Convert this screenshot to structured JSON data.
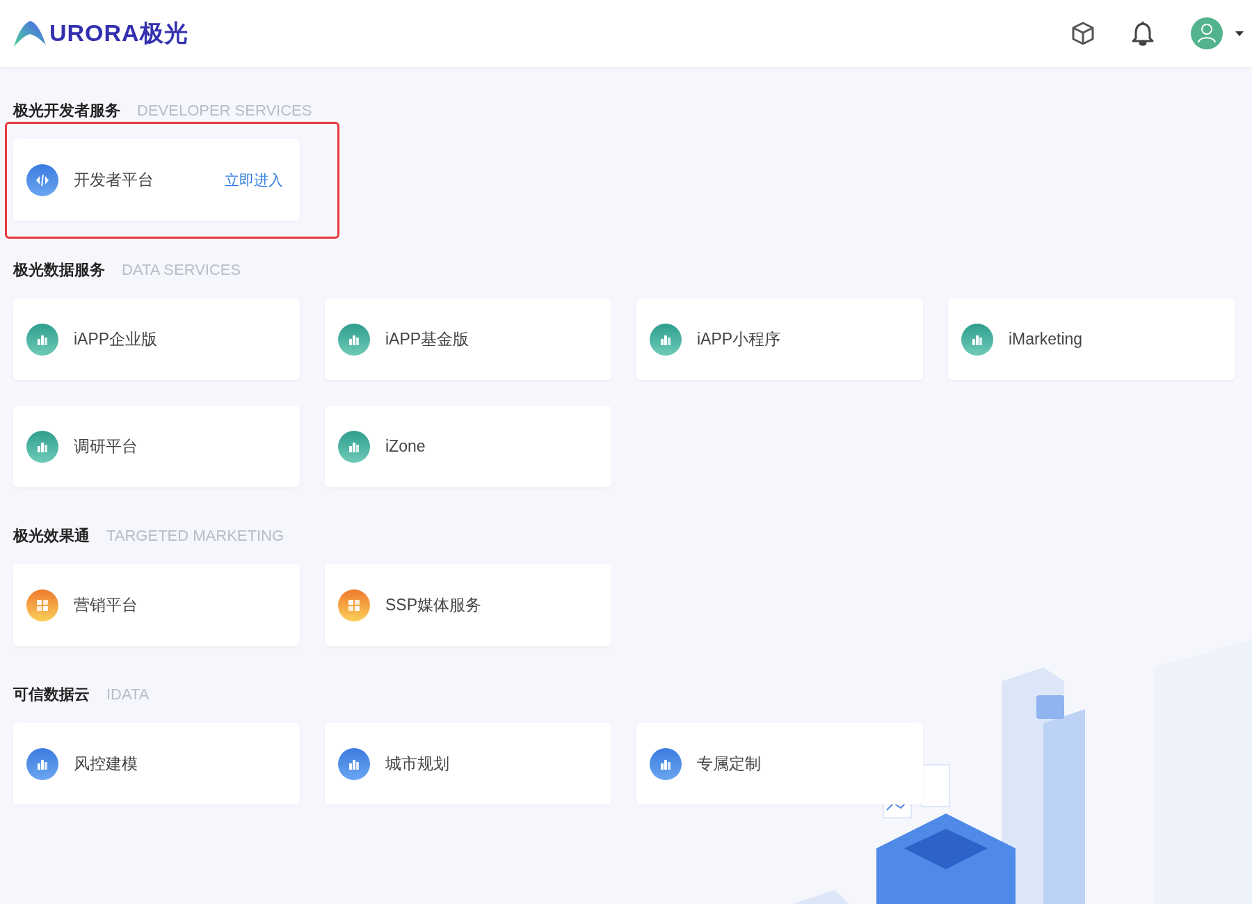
{
  "header": {
    "logo_text": "URORA极光"
  },
  "sections": [
    {
      "title": "极光开发者服务",
      "subtitle": "DEVELOPER SERVICES",
      "kind": "blue",
      "highlighted": true,
      "cards": [
        {
          "name": "开发者平台",
          "action": "立即进入"
        }
      ]
    },
    {
      "title": "极光数据服务",
      "subtitle": "DATA SERVICES",
      "kind": "teal",
      "cards": [
        {
          "name": "iAPP企业版"
        },
        {
          "name": "iAPP基金版"
        },
        {
          "name": "iAPP小程序"
        },
        {
          "name": "iMarketing"
        },
        {
          "name": "调研平台"
        },
        {
          "name": "iZone"
        }
      ]
    },
    {
      "title": "极光效果通",
      "subtitle": "TARGETED MARKETING",
      "kind": "orange",
      "cards": [
        {
          "name": "营销平台"
        },
        {
          "name": "SSP媒体服务"
        }
      ]
    },
    {
      "title": "可信数据云",
      "subtitle": "IDATA",
      "kind": "blue",
      "cards": [
        {
          "name": "风控建模"
        },
        {
          "name": "城市规划"
        },
        {
          "name": "专属定制"
        }
      ]
    }
  ]
}
